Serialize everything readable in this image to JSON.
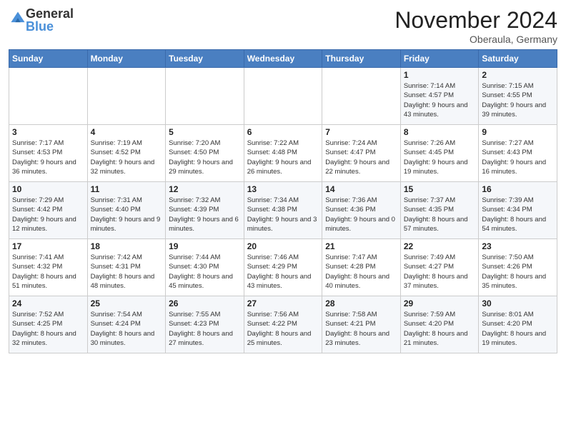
{
  "logo": {
    "general": "General",
    "blue": "Blue"
  },
  "title": "November 2024",
  "location": "Oberaula, Germany",
  "headers": [
    "Sunday",
    "Monday",
    "Tuesday",
    "Wednesday",
    "Thursday",
    "Friday",
    "Saturday"
  ],
  "weeks": [
    [
      {
        "day": "",
        "sunrise": "",
        "sunset": "",
        "daylight": ""
      },
      {
        "day": "",
        "sunrise": "",
        "sunset": "",
        "daylight": ""
      },
      {
        "day": "",
        "sunrise": "",
        "sunset": "",
        "daylight": ""
      },
      {
        "day": "",
        "sunrise": "",
        "sunset": "",
        "daylight": ""
      },
      {
        "day": "",
        "sunrise": "",
        "sunset": "",
        "daylight": ""
      },
      {
        "day": "1",
        "sunrise": "Sunrise: 7:14 AM",
        "sunset": "Sunset: 4:57 PM",
        "daylight": "Daylight: 9 hours and 43 minutes."
      },
      {
        "day": "2",
        "sunrise": "Sunrise: 7:15 AM",
        "sunset": "Sunset: 4:55 PM",
        "daylight": "Daylight: 9 hours and 39 minutes."
      }
    ],
    [
      {
        "day": "3",
        "sunrise": "Sunrise: 7:17 AM",
        "sunset": "Sunset: 4:53 PM",
        "daylight": "Daylight: 9 hours and 36 minutes."
      },
      {
        "day": "4",
        "sunrise": "Sunrise: 7:19 AM",
        "sunset": "Sunset: 4:52 PM",
        "daylight": "Daylight: 9 hours and 32 minutes."
      },
      {
        "day": "5",
        "sunrise": "Sunrise: 7:20 AM",
        "sunset": "Sunset: 4:50 PM",
        "daylight": "Daylight: 9 hours and 29 minutes."
      },
      {
        "day": "6",
        "sunrise": "Sunrise: 7:22 AM",
        "sunset": "Sunset: 4:48 PM",
        "daylight": "Daylight: 9 hours and 26 minutes."
      },
      {
        "day": "7",
        "sunrise": "Sunrise: 7:24 AM",
        "sunset": "Sunset: 4:47 PM",
        "daylight": "Daylight: 9 hours and 22 minutes."
      },
      {
        "day": "8",
        "sunrise": "Sunrise: 7:26 AM",
        "sunset": "Sunset: 4:45 PM",
        "daylight": "Daylight: 9 hours and 19 minutes."
      },
      {
        "day": "9",
        "sunrise": "Sunrise: 7:27 AM",
        "sunset": "Sunset: 4:43 PM",
        "daylight": "Daylight: 9 hours and 16 minutes."
      }
    ],
    [
      {
        "day": "10",
        "sunrise": "Sunrise: 7:29 AM",
        "sunset": "Sunset: 4:42 PM",
        "daylight": "Daylight: 9 hours and 12 minutes."
      },
      {
        "day": "11",
        "sunrise": "Sunrise: 7:31 AM",
        "sunset": "Sunset: 4:40 PM",
        "daylight": "Daylight: 9 hours and 9 minutes."
      },
      {
        "day": "12",
        "sunrise": "Sunrise: 7:32 AM",
        "sunset": "Sunset: 4:39 PM",
        "daylight": "Daylight: 9 hours and 6 minutes."
      },
      {
        "day": "13",
        "sunrise": "Sunrise: 7:34 AM",
        "sunset": "Sunset: 4:38 PM",
        "daylight": "Daylight: 9 hours and 3 minutes."
      },
      {
        "day": "14",
        "sunrise": "Sunrise: 7:36 AM",
        "sunset": "Sunset: 4:36 PM",
        "daylight": "Daylight: 9 hours and 0 minutes."
      },
      {
        "day": "15",
        "sunrise": "Sunrise: 7:37 AM",
        "sunset": "Sunset: 4:35 PM",
        "daylight": "Daylight: 8 hours and 57 minutes."
      },
      {
        "day": "16",
        "sunrise": "Sunrise: 7:39 AM",
        "sunset": "Sunset: 4:34 PM",
        "daylight": "Daylight: 8 hours and 54 minutes."
      }
    ],
    [
      {
        "day": "17",
        "sunrise": "Sunrise: 7:41 AM",
        "sunset": "Sunset: 4:32 PM",
        "daylight": "Daylight: 8 hours and 51 minutes."
      },
      {
        "day": "18",
        "sunrise": "Sunrise: 7:42 AM",
        "sunset": "Sunset: 4:31 PM",
        "daylight": "Daylight: 8 hours and 48 minutes."
      },
      {
        "day": "19",
        "sunrise": "Sunrise: 7:44 AM",
        "sunset": "Sunset: 4:30 PM",
        "daylight": "Daylight: 8 hours and 45 minutes."
      },
      {
        "day": "20",
        "sunrise": "Sunrise: 7:46 AM",
        "sunset": "Sunset: 4:29 PM",
        "daylight": "Daylight: 8 hours and 43 minutes."
      },
      {
        "day": "21",
        "sunrise": "Sunrise: 7:47 AM",
        "sunset": "Sunset: 4:28 PM",
        "daylight": "Daylight: 8 hours and 40 minutes."
      },
      {
        "day": "22",
        "sunrise": "Sunrise: 7:49 AM",
        "sunset": "Sunset: 4:27 PM",
        "daylight": "Daylight: 8 hours and 37 minutes."
      },
      {
        "day": "23",
        "sunrise": "Sunrise: 7:50 AM",
        "sunset": "Sunset: 4:26 PM",
        "daylight": "Daylight: 8 hours and 35 minutes."
      }
    ],
    [
      {
        "day": "24",
        "sunrise": "Sunrise: 7:52 AM",
        "sunset": "Sunset: 4:25 PM",
        "daylight": "Daylight: 8 hours and 32 minutes."
      },
      {
        "day": "25",
        "sunrise": "Sunrise: 7:54 AM",
        "sunset": "Sunset: 4:24 PM",
        "daylight": "Daylight: 8 hours and 30 minutes."
      },
      {
        "day": "26",
        "sunrise": "Sunrise: 7:55 AM",
        "sunset": "Sunset: 4:23 PM",
        "daylight": "Daylight: 8 hours and 27 minutes."
      },
      {
        "day": "27",
        "sunrise": "Sunrise: 7:56 AM",
        "sunset": "Sunset: 4:22 PM",
        "daylight": "Daylight: 8 hours and 25 minutes."
      },
      {
        "day": "28",
        "sunrise": "Sunrise: 7:58 AM",
        "sunset": "Sunset: 4:21 PM",
        "daylight": "Daylight: 8 hours and 23 minutes."
      },
      {
        "day": "29",
        "sunrise": "Sunrise: 7:59 AM",
        "sunset": "Sunset: 4:20 PM",
        "daylight": "Daylight: 8 hours and 21 minutes."
      },
      {
        "day": "30",
        "sunrise": "Sunrise: 8:01 AM",
        "sunset": "Sunset: 4:20 PM",
        "daylight": "Daylight: 8 hours and 19 minutes."
      }
    ]
  ]
}
